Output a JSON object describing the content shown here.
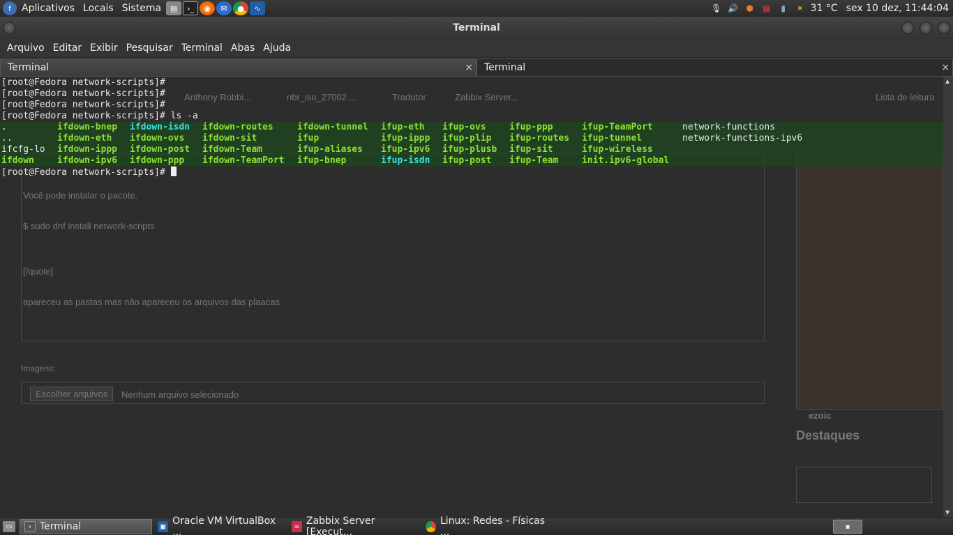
{
  "top_panel": {
    "menus": [
      "Aplicativos",
      "Locais",
      "Sistema"
    ],
    "weather": "31 °C",
    "clock": "sex 10 dez, 11:44:04"
  },
  "window": {
    "title": "Terminal",
    "menu": [
      "Arquivo",
      "Editar",
      "Exibir",
      "Pesquisar",
      "Terminal",
      "Abas",
      "Ajuda"
    ],
    "tabs": [
      {
        "label": "Terminal",
        "close": "×"
      },
      {
        "label": "Terminal",
        "close": "×"
      }
    ]
  },
  "terminal": {
    "prompt": "[root@Fedora network-scripts]#",
    "command": "ls -a",
    "ls_rows": [
      [
        [
          ".",
          "w"
        ],
        [
          "ifdown-bnep",
          "g"
        ],
        [
          "ifdown-isdn",
          "c"
        ],
        [
          "ifdown-routes",
          "g"
        ],
        [
          "ifdown-tunnel",
          "g"
        ],
        [
          "ifup-eth",
          "g"
        ],
        [
          "ifup-ovs",
          "g"
        ],
        [
          "ifup-ppp",
          "g"
        ],
        [
          "ifup-TeamPort",
          "g"
        ],
        [
          "network-functions",
          "w"
        ]
      ],
      [
        [
          "..",
          "w"
        ],
        [
          "ifdown-eth",
          "g"
        ],
        [
          "ifdown-ovs",
          "g"
        ],
        [
          "ifdown-sit",
          "g"
        ],
        [
          "ifup",
          "g"
        ],
        [
          "ifup-ippp",
          "g"
        ],
        [
          "ifup-plip",
          "g"
        ],
        [
          "ifup-routes",
          "g"
        ],
        [
          "ifup-tunnel",
          "g"
        ],
        [
          "network-functions-ipv6",
          "w"
        ]
      ],
      [
        [
          "ifcfg-lo",
          "w"
        ],
        [
          "ifdown-ippp",
          "g"
        ],
        [
          "ifdown-post",
          "g"
        ],
        [
          "ifdown-Team",
          "g"
        ],
        [
          "ifup-aliases",
          "g"
        ],
        [
          "ifup-ipv6",
          "g"
        ],
        [
          "ifup-plusb",
          "g"
        ],
        [
          "ifup-sit",
          "g"
        ],
        [
          "ifup-wireless",
          "g"
        ],
        [
          "",
          ""
        ]
      ],
      [
        [
          "ifdown",
          "g"
        ],
        [
          "ifdown-ipv6",
          "g"
        ],
        [
          "ifdown-ppp",
          "g"
        ],
        [
          "ifdown-TeamPort",
          "g"
        ],
        [
          "ifup-bnep",
          "g"
        ],
        [
          "ifup-isdn",
          "c"
        ],
        [
          "ifup-post",
          "g"
        ],
        [
          "ifup-Team",
          "g"
        ],
        [
          "init.ipv6-global",
          "g"
        ],
        [
          "",
          ""
        ]
      ]
    ]
  },
  "background_page": {
    "bookmarks": [
      "Anthony Robbi...",
      "nbr_iso_27002....",
      "Tradutor",
      "Zabbix Server...",
      "Lista de leitura"
    ],
    "text_lines": [
      "Você pode instalar o pacote.",
      "$ sudo dnf install network-scripts",
      "[/quote]",
      "apareceu as pastas mas não apareceu os arquivos das plaacas"
    ],
    "images_label": "Imagens:",
    "file_button": "Escolher arquivos",
    "file_status": "Nenhum arquivo selecionado",
    "ad_brand": "ezoic",
    "sidebar_heading": "Destaques"
  },
  "taskbar": {
    "tasks": [
      {
        "label": "Terminal",
        "icon": "terminal-icon",
        "color": "#555555"
      },
      {
        "label": "Oracle VM VirtualBox ...",
        "icon": "virtualbox-icon",
        "color": "#1f5fa8"
      },
      {
        "label": "Zabbix Server [Execut...",
        "icon": "zabbix-icon",
        "color": "#c8304a"
      },
      {
        "label": "Linux: Redes - Físicas ...",
        "icon": "chrome-icon",
        "color": "#4285f4"
      }
    ]
  }
}
